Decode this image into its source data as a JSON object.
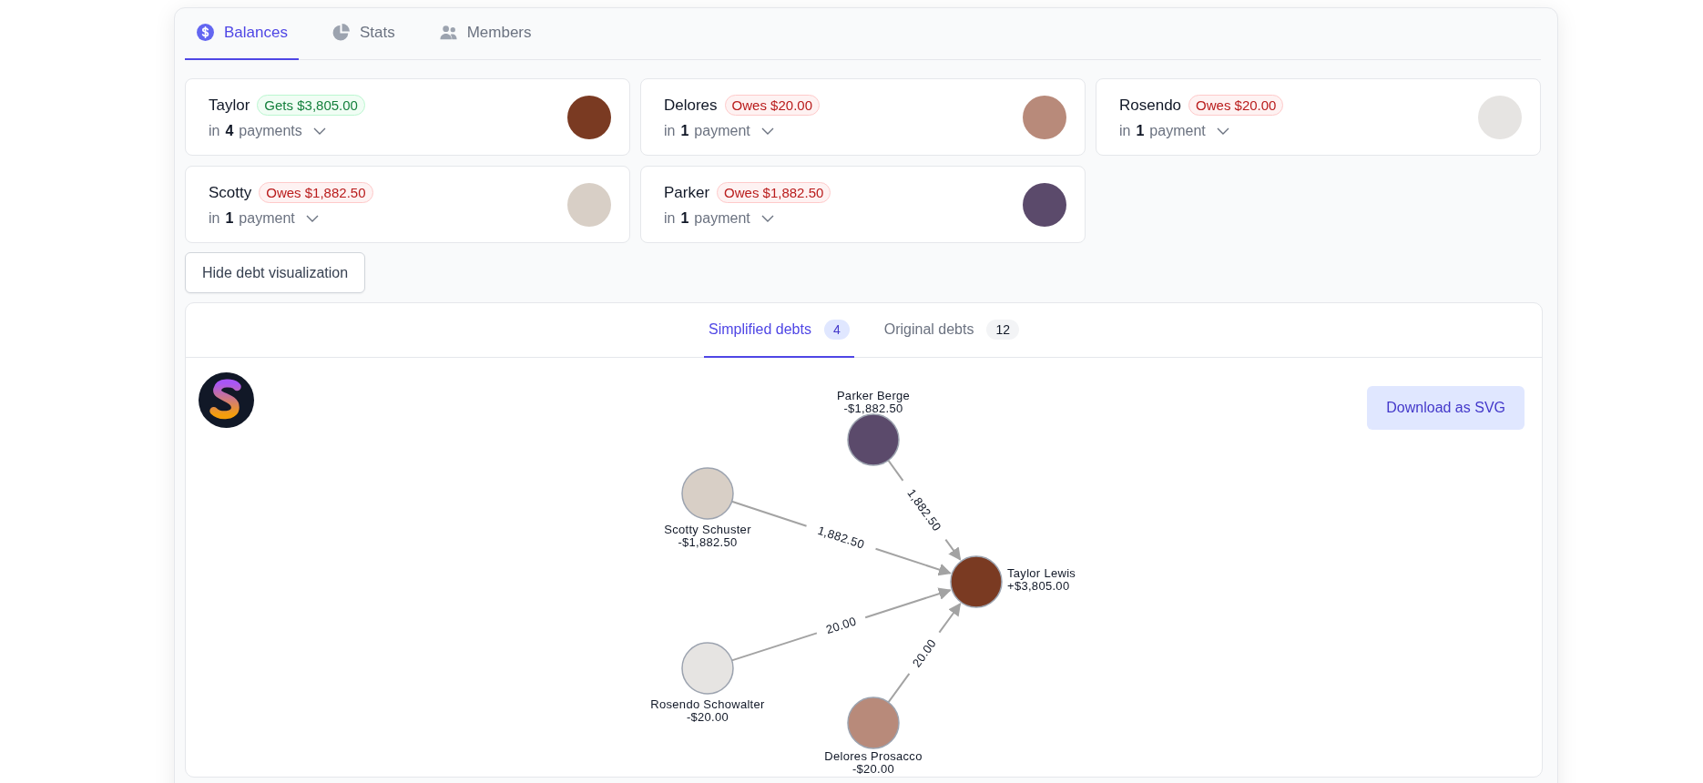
{
  "tabs": [
    {
      "label": "Balances",
      "selected": true
    },
    {
      "label": "Stats",
      "selected": false
    },
    {
      "label": "Members",
      "selected": false
    }
  ],
  "balances": [
    {
      "name": "Taylor",
      "kind": "gets",
      "badge": "Gets $3,805.00",
      "payments": "in **4** payments"
    },
    {
      "name": "Delores",
      "kind": "owes",
      "badge": "Owes $20.00",
      "payments": "in **1** payment"
    },
    {
      "name": "Rosendo",
      "kind": "owes",
      "badge": "Owes $20.00",
      "payments": "in **1** payment"
    },
    {
      "name": "Scotty",
      "kind": "owes",
      "badge": "Owes $1,882.50",
      "payments": "in **1** payment"
    },
    {
      "name": "Parker",
      "kind": "owes",
      "badge": "Owes $1,882.50",
      "payments": "in **1** payment"
    }
  ],
  "toggle_button": "Hide debt visualization",
  "debt_tabs": [
    {
      "label": "Simplified debts",
      "count": "4",
      "selected": true
    },
    {
      "label": "Original debts",
      "count": "12",
      "selected": false
    }
  ],
  "download_button": "Download as SVG",
  "graph": {
    "nodes": [
      {
        "name": "Parker Berge",
        "balance": "-$1,882.50"
      },
      {
        "name": "Scotty Schuster",
        "balance": "-$1,882.50"
      },
      {
        "name": "Taylor Lewis",
        "balance": "+$3,805.00"
      },
      {
        "name": "Rosendo Schowalter",
        "balance": "-$20.00"
      },
      {
        "name": "Delores Prosacco",
        "balance": "-$20.00"
      }
    ],
    "edges": [
      {
        "label": "1,882.50"
      },
      {
        "label": "1,882.50"
      },
      {
        "label": "20.00"
      },
      {
        "label": "20.00"
      }
    ]
  }
}
